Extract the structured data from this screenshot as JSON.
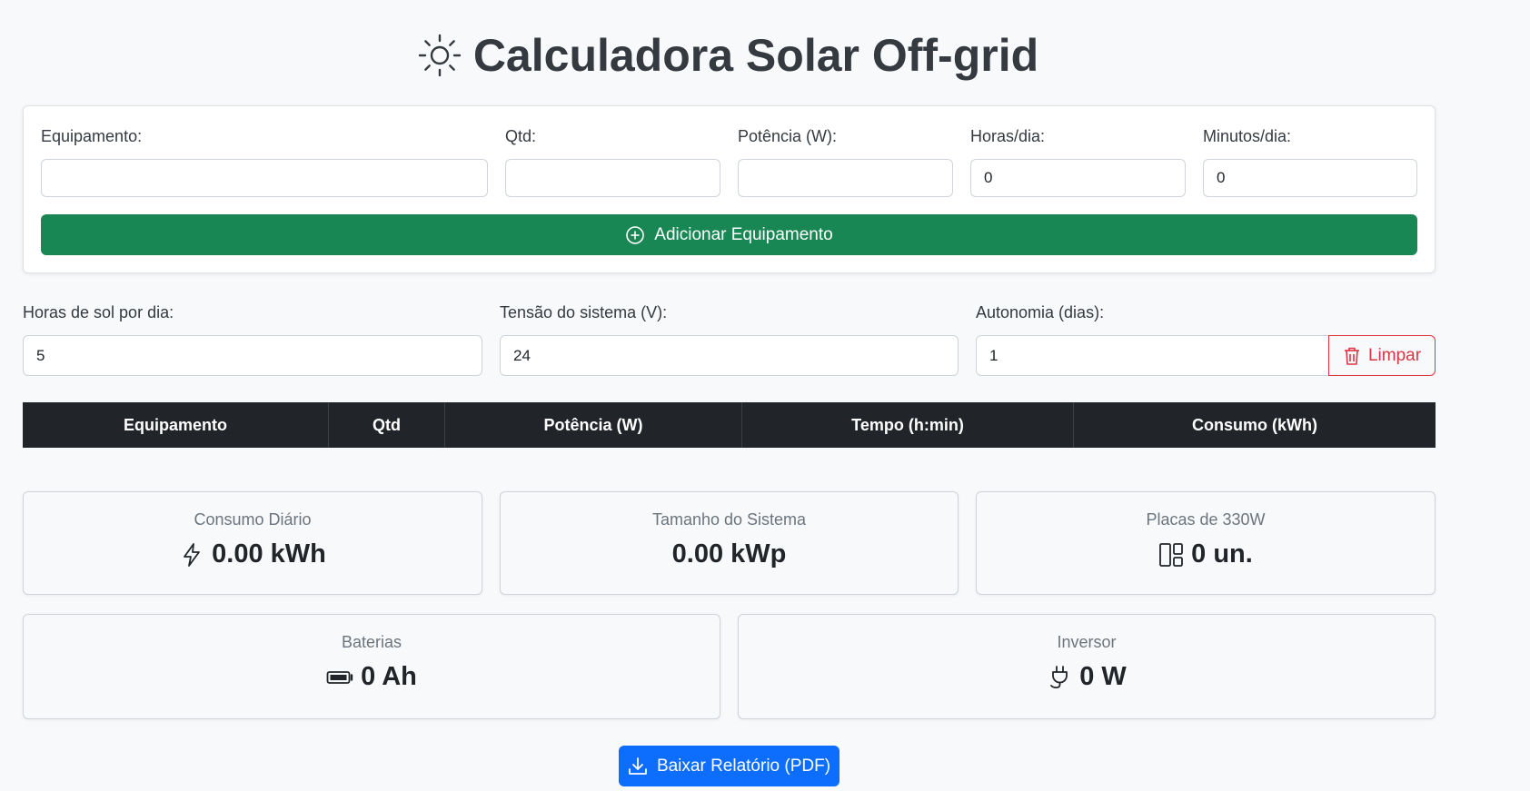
{
  "header": {
    "title": "Calculadora Solar Off-grid",
    "icon": "sun-icon"
  },
  "equipment_form": {
    "equipamento_label": "Equipamento:",
    "equipamento_value": "",
    "qtd_label": "Qtd:",
    "qtd_value": "",
    "potencia_label": "Potência (W):",
    "potencia_value": "",
    "horas_label": "Horas/dia:",
    "horas_value": "0",
    "minutos_label": "Minutos/dia:",
    "minutos_value": "0",
    "add_button_label": "Adicionar Equipamento"
  },
  "system_params": {
    "sun_hours_label": "Horas de sol por dia:",
    "sun_hours_value": "5",
    "voltage_label": "Tensão do sistema (V):",
    "voltage_value": "24",
    "autonomy_label": "Autonomia (dias):",
    "autonomy_value": "1",
    "clear_button_label": "Limpar"
  },
  "table": {
    "headers": [
      "Equipamento",
      "Qtd",
      "Potência (W)",
      "Tempo (h:min)",
      "Consumo (kWh)"
    ],
    "rows": []
  },
  "results": {
    "daily_consumption": {
      "label": "Consumo Diário",
      "value": "0.00 kWh",
      "icon": "lightning-icon"
    },
    "system_size": {
      "label": "Tamanho do Sistema",
      "value": "0.00 kWp"
    },
    "panels": {
      "label": "Placas de 330W",
      "value": "0 un.",
      "icon": "panels-icon"
    },
    "batteries": {
      "label": "Baterias",
      "value": "0 Ah",
      "icon": "battery-icon"
    },
    "inverter": {
      "label": "Inversor",
      "value": "0 W",
      "icon": "plug-icon"
    }
  },
  "download_button_label": "Baixar Relatório (PDF)",
  "colors": {
    "add_button": "#198754",
    "clear_button": "#dc3545",
    "table_header": "#212529",
    "download_button": "#0d6efd"
  }
}
